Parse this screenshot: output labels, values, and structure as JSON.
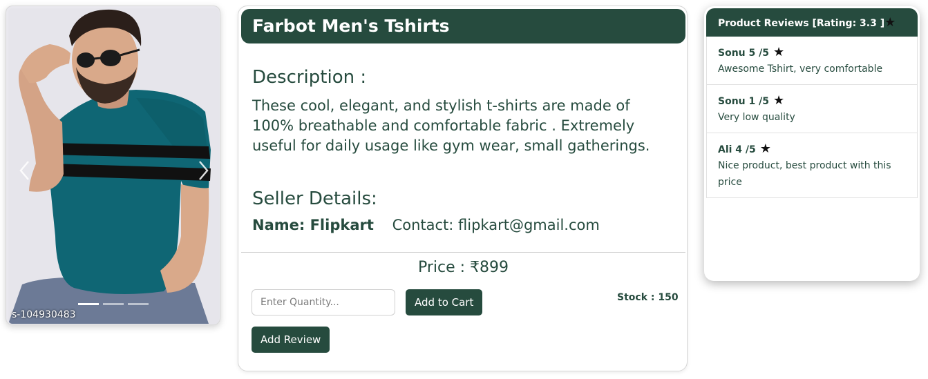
{
  "product": {
    "title": "Farbot Men's Tshirts",
    "description_heading": "Description :",
    "description": "These cool, elegant, and stylish t-shirts are made of 100% breathable and comfortable fabric . Extremely useful for daily usage like gym wear, small gatherings.",
    "seller_heading": "Seller Details:",
    "seller_name": "Name: Flipkart",
    "seller_contact": "Contact: flipkart@gmail.com",
    "price": "Price : ₹899",
    "quantity_placeholder": "Enter Quantity...",
    "add_to_cart_label": "Add to Cart",
    "stock": "Stock : 150",
    "add_review_label": "Add Review"
  },
  "carousel": {
    "caption": "s-104930483",
    "slide_count": 3,
    "active_slide": 1,
    "prev_icon": "chevron-left-icon",
    "next_icon": "chevron-right-icon"
  },
  "reviews": {
    "header": "Product Reviews [Rating: 3.3 ]",
    "star_icon": "star-icon",
    "items": [
      {
        "title": "Sonu 5 /5",
        "text": "Awesome Tshirt, very comfortable"
      },
      {
        "title": "Sonu 1 /5",
        "text": "Very low quality"
      },
      {
        "title": "Ali 4 /5",
        "text": "Nice product, best product with this price"
      }
    ]
  },
  "colors": {
    "brand_green": "#264b3e",
    "shirt_teal": "#0f6674"
  }
}
